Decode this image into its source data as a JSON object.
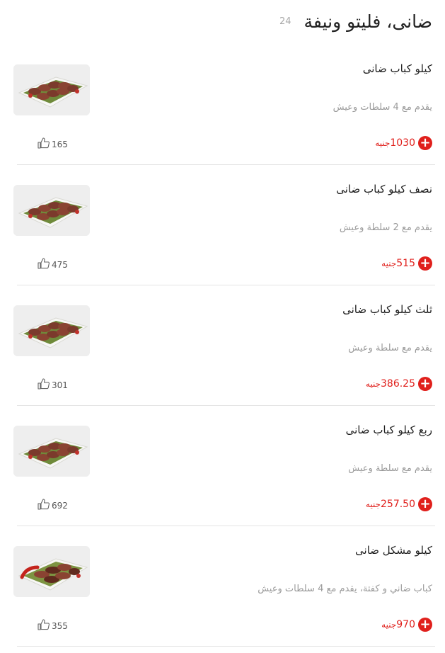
{
  "header": {
    "title": "ضانى، فليتو ونيفة",
    "count": "24"
  },
  "currency_label": "جنيه",
  "colors": {
    "accent": "#e0201c",
    "muted": "#9a9a9a"
  },
  "items": [
    {
      "name": "كيلو كباب ضانى",
      "description": "يقدم مع 4 سلطات وعيش",
      "price": "1030",
      "likes": "165"
    },
    {
      "name": "نصف كيلو كباب ضانى",
      "description": "يقدم مع 2 سلطة وعيش",
      "price": "515",
      "likes": "475"
    },
    {
      "name": "ثلث كيلو كباب ضانى",
      "description": "يقدم مع سلطة وعيش",
      "price": "386.25",
      "likes": "301"
    },
    {
      "name": "ربع كيلو كباب ضانى",
      "description": "يقدم مع سلطة وعيش",
      "price": "257.50",
      "likes": "692"
    },
    {
      "name": "كيلو مشكل ضانى",
      "description": "كباب ضاني و كفتة، يقدم مع 4 سلطات وعيش",
      "price": "970",
      "likes": "355"
    }
  ]
}
